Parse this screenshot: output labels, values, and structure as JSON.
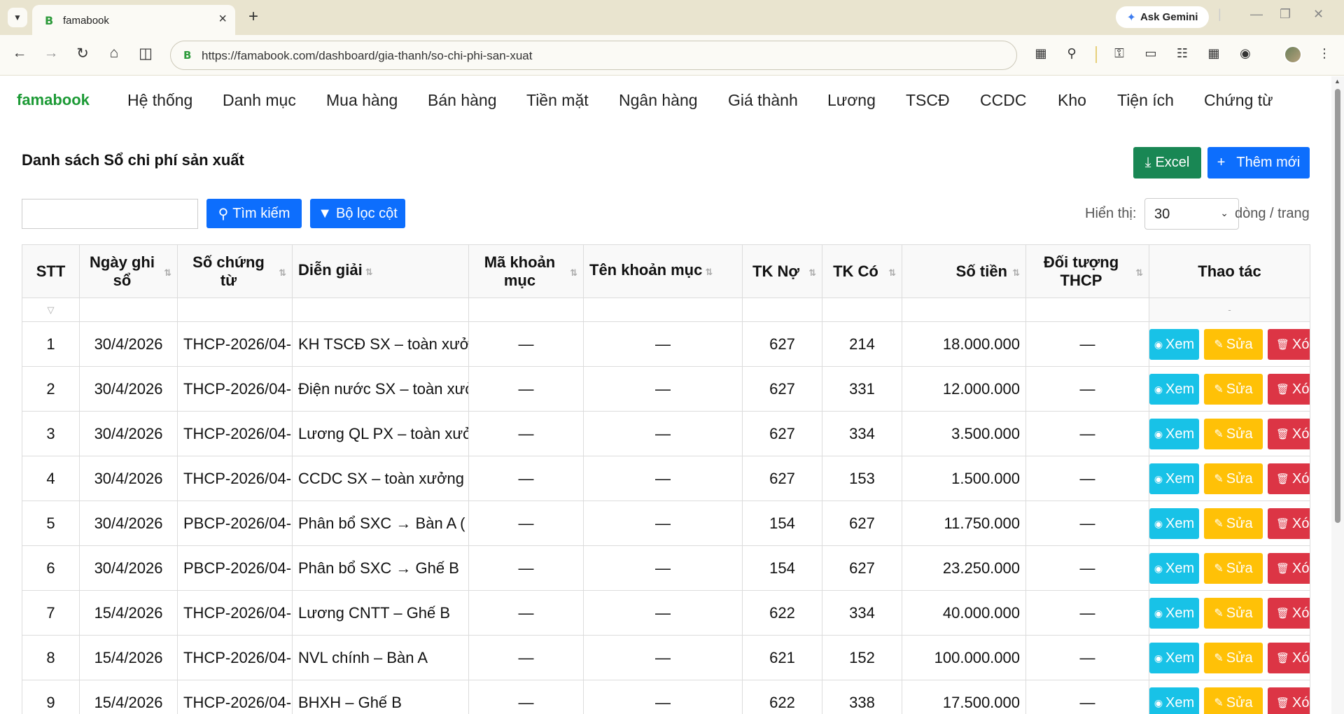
{
  "browser": {
    "tab_title": "famabook",
    "tab_favicon": "B",
    "new_tab": "+",
    "gemini_label": "Ask Gemini",
    "url": "https://famabook.com/dashboard/gia-thanh/so-chi-phi-san-xuat"
  },
  "nav": {
    "brand": "famabook",
    "items": [
      "Hệ thống",
      "Danh mục",
      "Mua hàng",
      "Bán hàng",
      "Tiền mặt",
      "Ngân hàng",
      "Giá thành",
      "Lương",
      "TSCĐ",
      "CCDC",
      "Kho",
      "Tiện ích",
      "Chứng từ"
    ]
  },
  "page": {
    "title": "Danh sách Sổ chi phí sản xuất",
    "excel_label": "Excel",
    "add_label": "Thêm mới",
    "search_placeholder": "",
    "search_label": "Tìm kiếm",
    "filter_label": "Bộ lọc cột",
    "show_label": "Hiển thị:",
    "page_size": "30",
    "rows_label": "dòng / trang"
  },
  "table": {
    "headers": {
      "stt": "STT",
      "ngay": "Ngày ghi sổ",
      "so_ct": "Số chứng từ",
      "dien_giai": "Diễn giải",
      "ma_km": "Mã khoản mục",
      "ten_km": "Tên khoản mục",
      "tk_no": "TK Nợ",
      "tk_co": "TK Có",
      "so_tien": "Số tiền",
      "doi_tuong": "Đối tượng THCP",
      "thao_tac": "Thao tác"
    },
    "filter_dash": "-",
    "action_labels": {
      "view": "Xem",
      "edit": "Sửa",
      "delete": "Xóa"
    },
    "rows": [
      {
        "stt": "1",
        "ngay": "30/4/2026",
        "so_ct": "THCP-2026/04-",
        "dien_giai": "KH TSCĐ SX – toàn xưởng",
        "ma_km": "—",
        "ten_km": "—",
        "tk_no": "627",
        "tk_co": "214",
        "so_tien": "18.000.000",
        "doi_tuong": "—"
      },
      {
        "stt": "2",
        "ngay": "30/4/2026",
        "so_ct": "THCP-2026/04-",
        "dien_giai": "Điện nước SX – toàn xưởng",
        "ma_km": "—",
        "ten_km": "—",
        "tk_no": "627",
        "tk_co": "331",
        "so_tien": "12.000.000",
        "doi_tuong": "—"
      },
      {
        "stt": "3",
        "ngay": "30/4/2026",
        "so_ct": "THCP-2026/04-",
        "dien_giai": "Lương QL PX – toàn xưởng",
        "ma_km": "—",
        "ten_km": "—",
        "tk_no": "627",
        "tk_co": "334",
        "so_tien": "3.500.000",
        "doi_tuong": "—"
      },
      {
        "stt": "4",
        "ngay": "30/4/2026",
        "so_ct": "THCP-2026/04-",
        "dien_giai": "CCDC SX – toàn xưởng",
        "ma_km": "—",
        "ten_km": "—",
        "tk_no": "627",
        "tk_co": "153",
        "so_tien": "1.500.000",
        "doi_tuong": "—"
      },
      {
        "stt": "5",
        "ngay": "30/4/2026",
        "so_ct": "PBCP-2026/04-",
        "dien_giai": "Phân bổ SXC → Bàn A (",
        "ma_km": "—",
        "ten_km": "—",
        "tk_no": "154",
        "tk_co": "627",
        "so_tien": "11.750.000",
        "doi_tuong": "—"
      },
      {
        "stt": "6",
        "ngay": "30/4/2026",
        "so_ct": "PBCP-2026/04-",
        "dien_giai": "Phân bổ SXC → Ghế B",
        "ma_km": "—",
        "ten_km": "—",
        "tk_no": "154",
        "tk_co": "627",
        "so_tien": "23.250.000",
        "doi_tuong": "—"
      },
      {
        "stt": "7",
        "ngay": "15/4/2026",
        "so_ct": "THCP-2026/04-",
        "dien_giai": "Lương CNTT – Ghế B",
        "ma_km": "—",
        "ten_km": "—",
        "tk_no": "622",
        "tk_co": "334",
        "so_tien": "40.000.000",
        "doi_tuong": "—"
      },
      {
        "stt": "8",
        "ngay": "15/4/2026",
        "so_ct": "THCP-2026/04-",
        "dien_giai": "NVL chính – Bàn A",
        "ma_km": "—",
        "ten_km": "—",
        "tk_no": "621",
        "tk_co": "152",
        "so_tien": "100.000.000",
        "doi_tuong": "—"
      },
      {
        "stt": "9",
        "ngay": "15/4/2026",
        "so_ct": "THCP-2026/04-",
        "dien_giai": "BHXH – Ghế B",
        "ma_km": "—",
        "ten_km": "—",
        "tk_no": "622",
        "tk_co": "338",
        "so_tien": "17.500.000",
        "doi_tuong": "—"
      }
    ]
  },
  "colors": {
    "brand": "#1c9a35",
    "primary": "#0d6efd",
    "success": "#198754",
    "info": "#18c2e7",
    "warning": "#ffc107",
    "danger": "#dc3545",
    "money": "#2e9b3c"
  }
}
